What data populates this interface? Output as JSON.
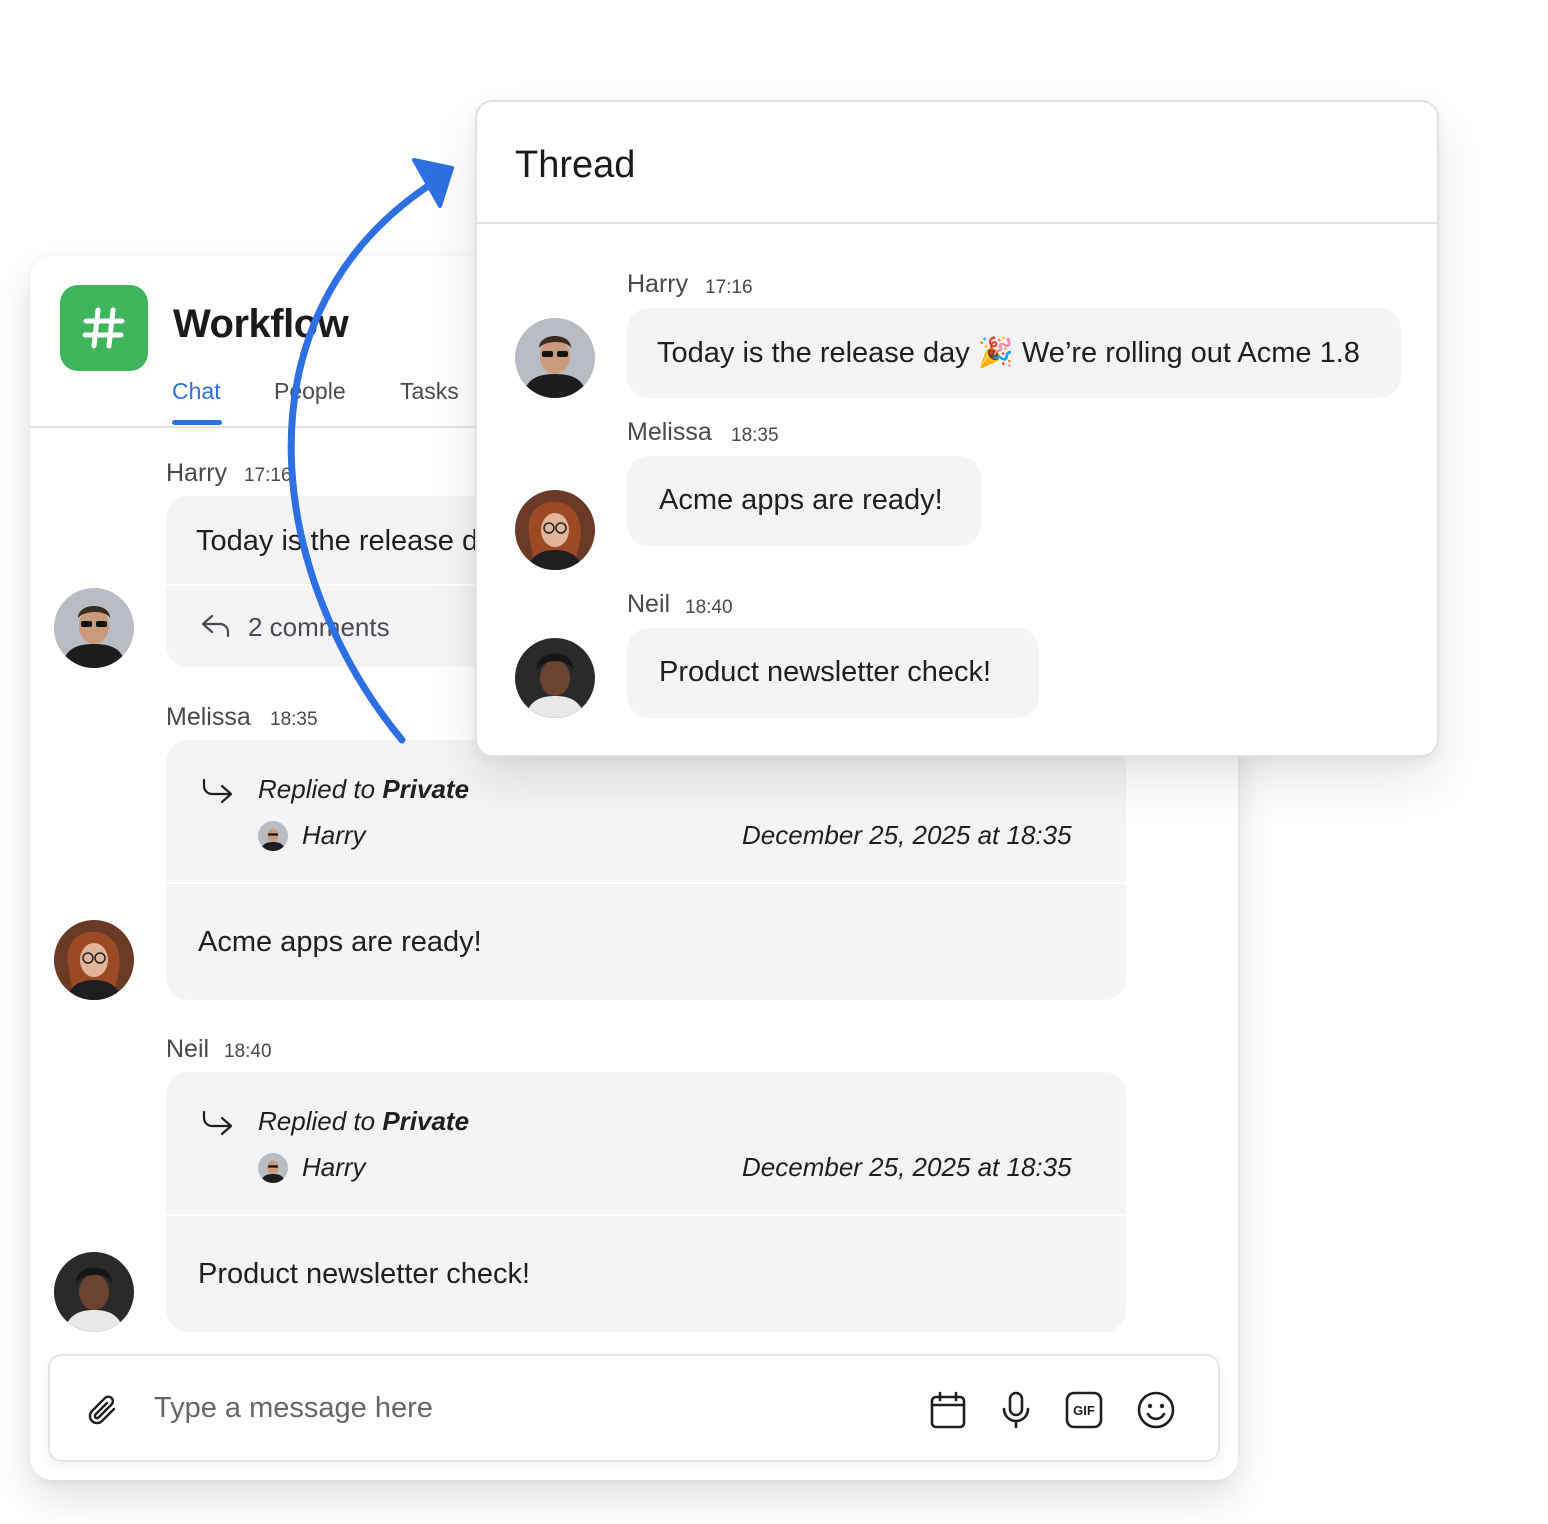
{
  "channel": {
    "icon": "hash-icon",
    "title": "Workflow",
    "tabs": [
      {
        "label": "Chat",
        "active": true
      },
      {
        "label": "People",
        "active": false
      },
      {
        "label": "Tasks",
        "active": false
      }
    ]
  },
  "messages": [
    {
      "author": "Harry",
      "time": "17:16",
      "text": "Today is the release day 🎉 We’re rolling out Acme  1.8",
      "comments": "2 comments"
    },
    {
      "author": "Melissa",
      "time": "18:35",
      "reply": {
        "prefix": "Replied to ",
        "target": "Private",
        "user": "Harry",
        "date": "December 25, 2025 at 18:35"
      },
      "text": "Acme apps are ready!"
    },
    {
      "author": "Neil",
      "time": "18:40",
      "reply": {
        "prefix": "Replied to ",
        "target": "Private",
        "user": "Harry",
        "date": "December 25, 2025 at 18:35"
      },
      "text": "Product newsletter check!"
    }
  ],
  "composer": {
    "placeholder": "Type a message here",
    "icons": [
      "paperclip-icon",
      "calendar-icon",
      "microphone-icon",
      "gif-icon",
      "emoji-icon"
    ]
  },
  "thread": {
    "title": "Thread",
    "messages": [
      {
        "author": "Harry",
        "time": "17:16",
        "text": "Today is the release day 🎉 We’re rolling out Acme  1.8"
      },
      {
        "author": "Melissa",
        "time": "18:35",
        "text": "Acme apps are ready!"
      },
      {
        "author": "Neil",
        "time": "18:40",
        "text": "Product newsletter check!"
      }
    ]
  },
  "colors": {
    "accent": "#2f6fe4",
    "channel_icon": "#3fb55c",
    "bubble": "#f4f4f6",
    "arrow": "#2f6fe4"
  }
}
